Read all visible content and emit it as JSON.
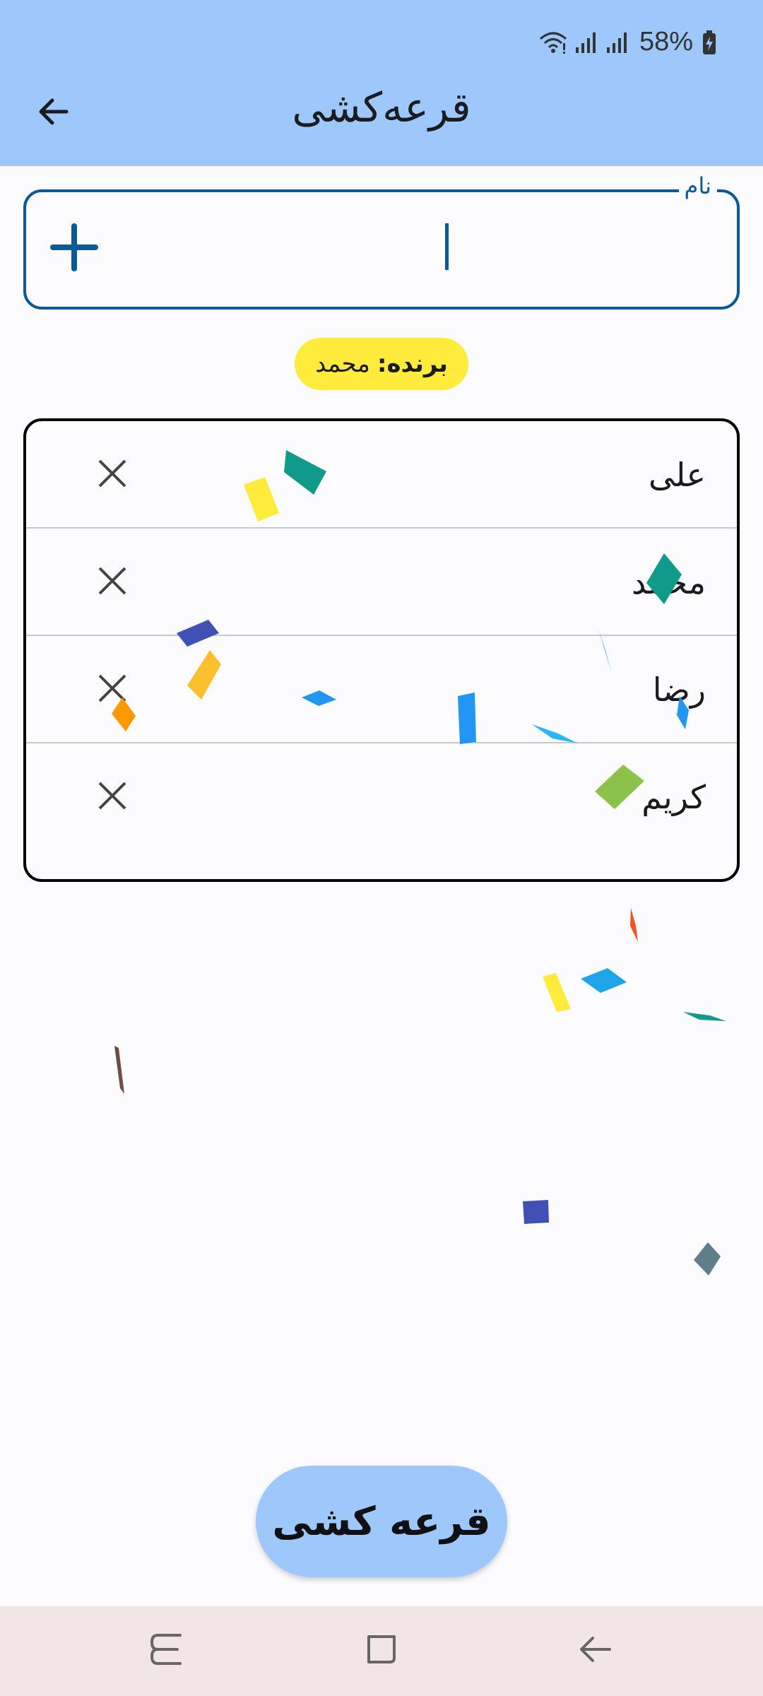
{
  "status_bar": {
    "battery_percent": "58%",
    "icons": [
      "wifi-icon",
      "signal-icon",
      "signal-icon",
      "battery-charging-icon"
    ]
  },
  "app_bar": {
    "title": "قرعه‌کشی",
    "back_icon": "arrow-back-icon"
  },
  "name_input": {
    "label": "نام",
    "value": "",
    "add_icon": "plus-icon"
  },
  "winner": {
    "label": "برنده:",
    "name": "محمد",
    "color": "#ffeb3b"
  },
  "participants": [
    {
      "name": "علی"
    },
    {
      "name": "محمد"
    },
    {
      "name": "رضا"
    },
    {
      "name": "کریم"
    }
  ],
  "draw_button": {
    "label": "قرعه کشی"
  },
  "nav_bar": {
    "icons": [
      "recent-apps-icon",
      "home-icon",
      "back-icon"
    ]
  },
  "colors": {
    "primary": "#0b5a95",
    "app_bar": "#9ec8fc",
    "nav_bar": "#f1e5e6"
  }
}
